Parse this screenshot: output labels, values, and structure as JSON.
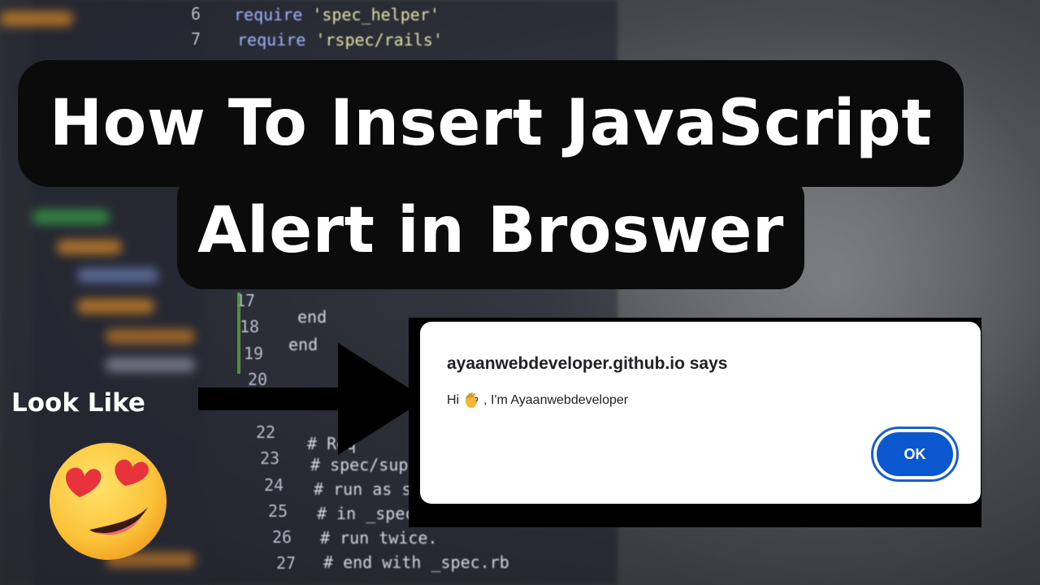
{
  "thumbnail": {
    "title_line_1": "How To Insert JavaScript",
    "title_line_2": "Alert in Broswer",
    "left_label": "Look Like",
    "emoji_icon": "heart-eyes-emoji-icon",
    "arrow_icon": "right-arrow-icon"
  },
  "background_code": {
    "line_numbers": [
      "6",
      "7",
      "17",
      "18",
      "19",
      "20",
      "22",
      "23",
      "24",
      "25",
      "26",
      "27"
    ],
    "lines": [
      {
        "kw": "require",
        "str": "'spec_helper'"
      },
      {
        "kw": "require",
        "str": "'rspec/rails'"
      },
      {
        "text": "end"
      },
      {
        "text": "end"
      },
      {
        "text": "# Req"
      },
      {
        "text": "# spec/support/"
      },
      {
        "text": "# run as spec f"
      },
      {
        "text": "# in _spec.rb"
      },
      {
        "text": "# run twice."
      },
      {
        "text": "# end with _spec.rb"
      }
    ]
  },
  "alert_dialog": {
    "title": "ayaanwebdeveloper.github.io says",
    "message_prefix": "Hi",
    "message_icon": "waving-hand-icon",
    "message_suffix": ", I'm Ayaanwebdeveloper",
    "ok_label": "OK"
  },
  "colors": {
    "pill_background": "#0b0b0c",
    "ok_button": "#0b57d0",
    "ok_ring": "#1a5fd0"
  }
}
